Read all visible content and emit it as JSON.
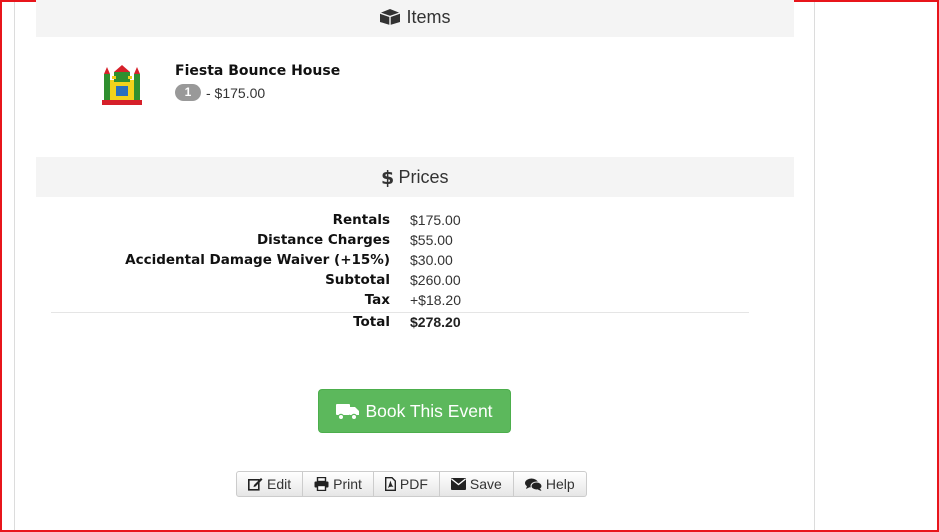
{
  "items_section": {
    "title": "Items",
    "icon": "box-icon",
    "items": [
      {
        "name": "Fiesta Bounce House",
        "quantity": "1",
        "price": "- $175.00",
        "thumbnail": "bounce-house-image"
      }
    ]
  },
  "prices_section": {
    "title": "Prices",
    "icon": "dollar-icon",
    "rows": [
      {
        "label": "Rentals",
        "value": "$175.00"
      },
      {
        "label": "Distance Charges",
        "value": "$55.00"
      },
      {
        "label": "Accidental Damage Waiver (+15%)",
        "value": "$30.00"
      },
      {
        "label": "Subtotal",
        "value": "$260.00"
      },
      {
        "label": "Tax",
        "value": "+$18.20"
      }
    ],
    "total": {
      "label": "Total",
      "value": "$278.20"
    }
  },
  "book_button": {
    "label": "Book This Event",
    "icon": "truck-icon",
    "color": "#5cb85c"
  },
  "actions": [
    {
      "label": "Edit",
      "icon": "edit-icon"
    },
    {
      "label": "Print",
      "icon": "print-icon"
    },
    {
      "label": "PDF",
      "icon": "pdf-icon"
    },
    {
      "label": "Save",
      "icon": "envelope-icon"
    },
    {
      "label": "Help",
      "icon": "comments-icon"
    }
  ],
  "colors": {
    "frame_border": "#e8151b",
    "section_bg": "#f4f4f4",
    "badge": "#999999"
  }
}
